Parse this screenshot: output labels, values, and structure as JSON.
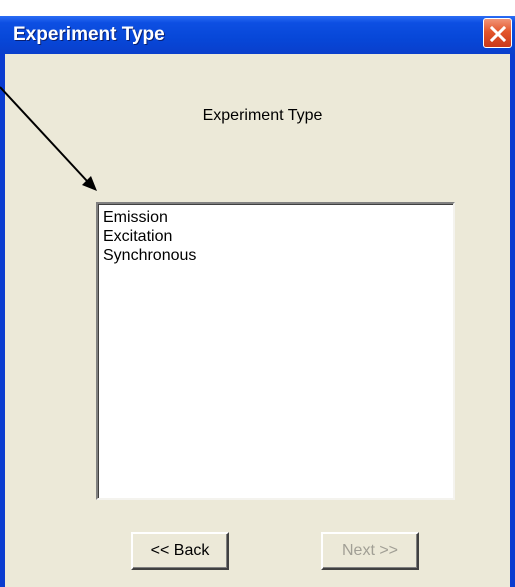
{
  "window": {
    "title": "Experiment Type",
    "close_icon": "close-x-icon"
  },
  "experiment": {
    "group_label": "Experiment Type",
    "options": [
      "Emission",
      "Excitation",
      "Synchronous"
    ]
  },
  "buttons": {
    "back_label": "<< Back",
    "next_label": "Next >>",
    "next_enabled": false
  },
  "annotation": {
    "icon": "pointer-arrow-icon",
    "color": "#000000"
  }
}
